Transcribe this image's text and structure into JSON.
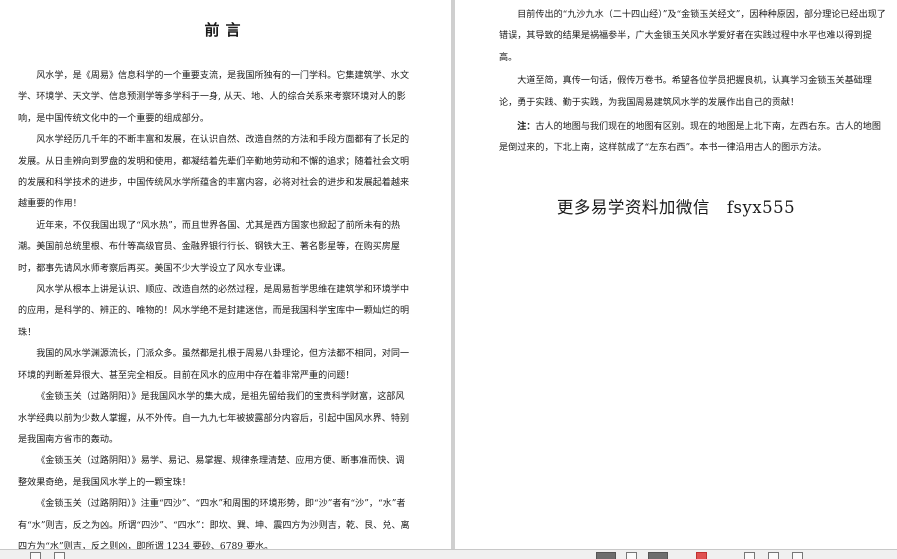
{
  "left_page": {
    "title": "前言",
    "paragraphs": [
      "风水学，是《周易》信息科学的一个重要支流，是我国所独有的一门学科。它集建筑学、水文学、环境学、天文学、信息预测学等多学科于一身, 从天、地、人的综合关系来考察环境对人的影响，是中国传统文化中的一个重要的组成部分。",
      "风水学经历几千年的不断丰富和发展，在认识自然、改造自然的方法和手段方面都有了长足的发展。从日圭辨向到罗盘的发明和使用，都凝结着先辈们辛勤地劳动和不懈的追求；随着社会文明的发展和科学技术的进步，中国传统风水学所蕴含的丰富内容，必将对社会的进步和发展起着越来越重要的作用！",
      " 近年来，不仅我国出现了“风水热”，而且世界各国、尤其是西方国家也掀起了前所未有的热潮。美国前总统里根、布什等高级官员、金融界银行行长、钢铁大王、著名影星等，在购买房屋时，都事先请风水师考察后再买。美国不少大学设立了风水专业课。",
      "风水学从根本上讲是认识、顺应、改造自然的必然过程，是周易哲学思维在建筑学和环境学中的应用，是科学的、辨正的、唯物的！风水学绝不是封建迷信，而是我国科学宝库中一颗灿烂的明珠！",
      "我国的风水学渊源流长，门派众多。虽然都是扎根于周易八卦理论，但方法都不相同，对同一环境的判断差异很大、甚至完全相反。目前在风水的应用中存在着非常严重的问题！",
      " 《金锁玉关（过路阴阳）》是我国风水学的集大成，是祖先留给我们的宝贵科学财富，这部风水学经典以前为少数人掌握，从不外传。自一九九七年被披露部分内容后，引起中国风水界、特别是我国南方省市的轰动。",
      "《金锁玉关（过路阴阳）》易学、易记、易掌握、规律条理清楚、应用方便、断事准而快、调整效果奇绝，是我国风水学上的一颗宝珠！",
      "《金锁玉关（过路阴阳）》注重“四沙”、“四水”和周围的环境形势，即“沙”者有“沙”，“水”者有“水”则吉，反之为凶。所谓“四沙”、“四水”：即坎、巽、坤、震四方为沙则吉，乾、艮、兑、离四方为“水”则吉，反之则凶，即所谓 1234 要砂、6789 要水。"
    ]
  },
  "right_page": {
    "paragraphs": [
      "目前传出的“九沙九水（二十四山经）”及“金锁玉关经文”，因种种原因，部分理论已经出现了错误，其导致的结果是祸福参半，广大金锁玉关风水学爱好者在实践过程中水平也难以得到提高。",
      "大道至简，真传一句话，假传万卷书。希望各位学员把握良机，认真学习金锁玉关基础理论，勇于实践、勤于实践，为我国周易建筑风水学的发展作出自己的贡献！"
    ],
    "note_label": "注：",
    "note_text": "古人的地图与我们现在的地图有区别。现在的地图是上北下南，左西右东。古人的地图是倒过来的，下北上南，这样就成了“左东右西”。本书一律沿用古人的图示方法。",
    "promo": "更多易学资料加微信　fsyx555"
  },
  "toolbar": {
    "buttons": [
      "single-page-view",
      "page-view",
      "two-page-view",
      "dual-page-view",
      "fit-view",
      "scroll-view",
      "zoom-out",
      "zoom-in",
      "rotate"
    ]
  }
}
